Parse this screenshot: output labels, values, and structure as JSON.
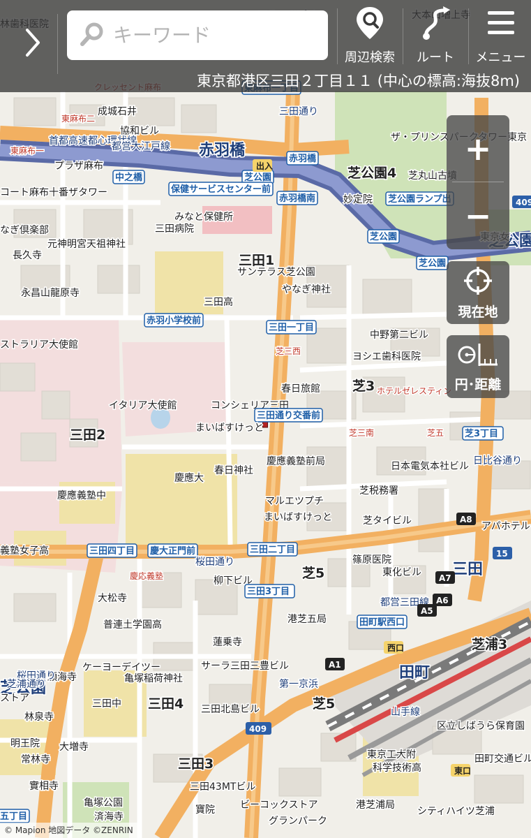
{
  "header": {
    "back_label": "›",
    "search_placeholder": "キーワード",
    "nearby_label": "周辺検索",
    "route_label": "ルート",
    "menu_label": "メニュー",
    "address": "東京都港区三田２丁目１１ (中心の標高:海抜8m)"
  },
  "controls": {
    "zoom_in": "+",
    "zoom_out": "−",
    "locate_label": "現在地",
    "distance_label": "円･距離"
  },
  "footer": {
    "copyright": "© Mapion 地図データ ©ZENRIN"
  },
  "map": {
    "labels": [
      {
        "text": "林歯科医院",
        "kind": "poi"
      },
      {
        "text": "マルエツプチ",
        "kind": "poi"
      },
      {
        "text": "大本山増上寺",
        "kind": "poi"
      },
      {
        "text": "クレッセント麻布",
        "kind": "small"
      },
      {
        "text": "東麻布一丁目",
        "kind": "station"
      },
      {
        "text": "成城石井",
        "kind": "poi"
      },
      {
        "text": "協和ビル",
        "kind": "poi"
      },
      {
        "text": "東麻布二",
        "kind": "small"
      },
      {
        "text": "首都高速都心環状線",
        "kind": "road"
      },
      {
        "text": "都営大江戸線",
        "kind": "road"
      },
      {
        "text": "赤羽橋",
        "kind": "major"
      },
      {
        "text": "赤羽橋",
        "kind": "station"
      },
      {
        "text": "東麻布一",
        "kind": "small"
      },
      {
        "text": "プラザ麻布",
        "kind": "poi"
      },
      {
        "text": "中之橋",
        "kind": "station"
      },
      {
        "text": "芝公園",
        "kind": "station"
      },
      {
        "text": "ザ・プリンスパークタワー東京",
        "kind": "poi"
      },
      {
        "text": "芝公園4",
        "kind": "district"
      },
      {
        "text": "芝丸山古墳",
        "kind": "poi"
      },
      {
        "text": "コート麻布十番ザタワー",
        "kind": "poi"
      },
      {
        "text": "保健サービスセンター前",
        "kind": "station"
      },
      {
        "text": "赤羽橋南",
        "kind": "station"
      },
      {
        "text": "妙定院",
        "kind": "poi"
      },
      {
        "text": "芝公園ランプ出",
        "kind": "station"
      },
      {
        "text": "なぎ倶楽部",
        "kind": "poi"
      },
      {
        "text": "みなと保健所",
        "kind": "poi"
      },
      {
        "text": "三田病院",
        "kind": "poi"
      },
      {
        "text": "元神明宮天祖神社",
        "kind": "poi"
      },
      {
        "text": "長久寺",
        "kind": "poi"
      },
      {
        "text": "芝公園",
        "kind": "station"
      },
      {
        "text": "芝公園",
        "kind": "major"
      },
      {
        "text": "三田1",
        "kind": "district"
      },
      {
        "text": "サンテラス芝公園",
        "kind": "poi"
      },
      {
        "text": "芝公園",
        "kind": "station"
      },
      {
        "text": "永昌山龍原寺",
        "kind": "poi"
      },
      {
        "text": "やなぎ神社",
        "kind": "poi"
      },
      {
        "text": "三田高",
        "kind": "poi"
      },
      {
        "text": "現在地",
        "kind": "hidden"
      },
      {
        "text": "赤羽小学校前",
        "kind": "station"
      },
      {
        "text": "三田一丁目",
        "kind": "station"
      },
      {
        "text": "中野第二ビル",
        "kind": "poi"
      },
      {
        "text": "ストラリア大使館",
        "kind": "poi"
      },
      {
        "text": "芝三西",
        "kind": "small"
      },
      {
        "text": "ヨシエ歯科医院",
        "kind": "poi"
      },
      {
        "text": "芝3",
        "kind": "district"
      },
      {
        "text": "春日旅館",
        "kind": "poi"
      },
      {
        "text": "ホテルゼレスティン",
        "kind": "small"
      },
      {
        "text": "イタリア大使館",
        "kind": "poi"
      },
      {
        "text": "コンシェリア三田",
        "kind": "poi"
      },
      {
        "text": "三田2",
        "kind": "district"
      },
      {
        "text": "三田通り交番前",
        "kind": "station"
      },
      {
        "text": "まいばすけっと",
        "kind": "poi"
      },
      {
        "text": "芝三南",
        "kind": "small"
      },
      {
        "text": "芝五",
        "kind": "small"
      },
      {
        "text": "芝3丁目",
        "kind": "station"
      },
      {
        "text": "慶應義塾前局",
        "kind": "poi"
      },
      {
        "text": "日本電気本社ビル",
        "kind": "poi"
      },
      {
        "text": "春日神社",
        "kind": "poi"
      },
      {
        "text": "慶應大",
        "kind": "poi"
      },
      {
        "text": "慶應義塾中",
        "kind": "poi"
      },
      {
        "text": "芝税務署",
        "kind": "poi"
      },
      {
        "text": "マルエツプチ",
        "kind": "poi"
      },
      {
        "text": "まいばすけっと",
        "kind": "poi"
      },
      {
        "text": "芝タイビル",
        "kind": "poi"
      },
      {
        "text": "アパホテル",
        "kind": "poi"
      },
      {
        "text": "義塾女子高",
        "kind": "poi"
      },
      {
        "text": "三田四丁目",
        "kind": "station"
      },
      {
        "text": "慶大正門前",
        "kind": "station"
      },
      {
        "text": "三田二丁目",
        "kind": "station"
      },
      {
        "text": "桜田通り",
        "kind": "road"
      },
      {
        "text": "篠原医院",
        "kind": "poi"
      },
      {
        "text": "芝5",
        "kind": "district"
      },
      {
        "text": "東化ビル",
        "kind": "poi"
      },
      {
        "text": "三田",
        "kind": "major"
      },
      {
        "text": "慶応義塾",
        "kind": "small"
      },
      {
        "text": "柳下ビル",
        "kind": "poi"
      },
      {
        "text": "大松寺",
        "kind": "poi"
      },
      {
        "text": "三田3丁目",
        "kind": "station"
      },
      {
        "text": "都営三田線",
        "kind": "road"
      },
      {
        "text": "港芝五局",
        "kind": "poi"
      },
      {
        "text": "田町駅西口",
        "kind": "station"
      },
      {
        "text": "普連土学園高",
        "kind": "poi"
      },
      {
        "text": "芝浦3",
        "kind": "district"
      },
      {
        "text": "蓮乗寺",
        "kind": "poi"
      },
      {
        "text": "ケーヨーデイツー",
        "kind": "poi"
      },
      {
        "text": "サーラ三田三豊ビル",
        "kind": "poi"
      },
      {
        "text": "亀塚稲荷神社",
        "kind": "poi"
      },
      {
        "text": "願海寺",
        "kind": "poi"
      },
      {
        "text": "三田中",
        "kind": "poi"
      },
      {
        "text": "三田4",
        "kind": "district"
      },
      {
        "text": "田町",
        "kind": "major"
      },
      {
        "text": "芝5",
        "kind": "district"
      },
      {
        "text": "林泉寺",
        "kind": "poi"
      },
      {
        "text": "三田北島ビル",
        "kind": "poi"
      },
      {
        "text": "区立しばうら保育園",
        "kind": "poi"
      },
      {
        "text": "明王院",
        "kind": "poi"
      },
      {
        "text": "大増寺",
        "kind": "poi"
      },
      {
        "text": "常林寺",
        "kind": "poi"
      },
      {
        "text": "東京工大附",
        "kind": "poi"
      },
      {
        "text": "科学技術高",
        "kind": "poi"
      },
      {
        "text": "三田3",
        "kind": "district"
      },
      {
        "text": "實相寺",
        "kind": "poi"
      },
      {
        "text": "三田43MTビル",
        "kind": "poi"
      },
      {
        "text": "亀塚公園",
        "kind": "poi"
      },
      {
        "text": "済海寺",
        "kind": "poi"
      },
      {
        "text": "ビーコックストア",
        "kind": "poi"
      },
      {
        "text": "港芝浦局",
        "kind": "poi"
      },
      {
        "text": "グランパーク",
        "kind": "poi"
      },
      {
        "text": "シティハイツ芝浦",
        "kind": "poi"
      },
      {
        "text": "田町交通ビル",
        "kind": "poi"
      },
      {
        "text": "第一京浜",
        "kind": "road"
      },
      {
        "text": "山手線",
        "kind": "road"
      },
      {
        "text": "日比谷通り",
        "kind": "road"
      },
      {
        "text": "桜田通り",
        "kind": "road"
      },
      {
        "text": "三田通り",
        "kind": "road"
      },
      {
        "text": "東京女",
        "kind": "poi"
      },
      {
        "text": "芝公園",
        "kind": "major"
      },
      {
        "text": "ストア",
        "kind": "poi"
      },
      {
        "text": "五丁目",
        "kind": "station"
      },
      {
        "text": "寶院",
        "kind": "poi"
      },
      {
        "text": "芝浦通り",
        "kind": "road"
      }
    ],
    "road_badges": [
      "409",
      "409",
      "15",
      "A1",
      "A5",
      "A6",
      "A7",
      "A8",
      "西口",
      "東口",
      "出入"
    ]
  }
}
